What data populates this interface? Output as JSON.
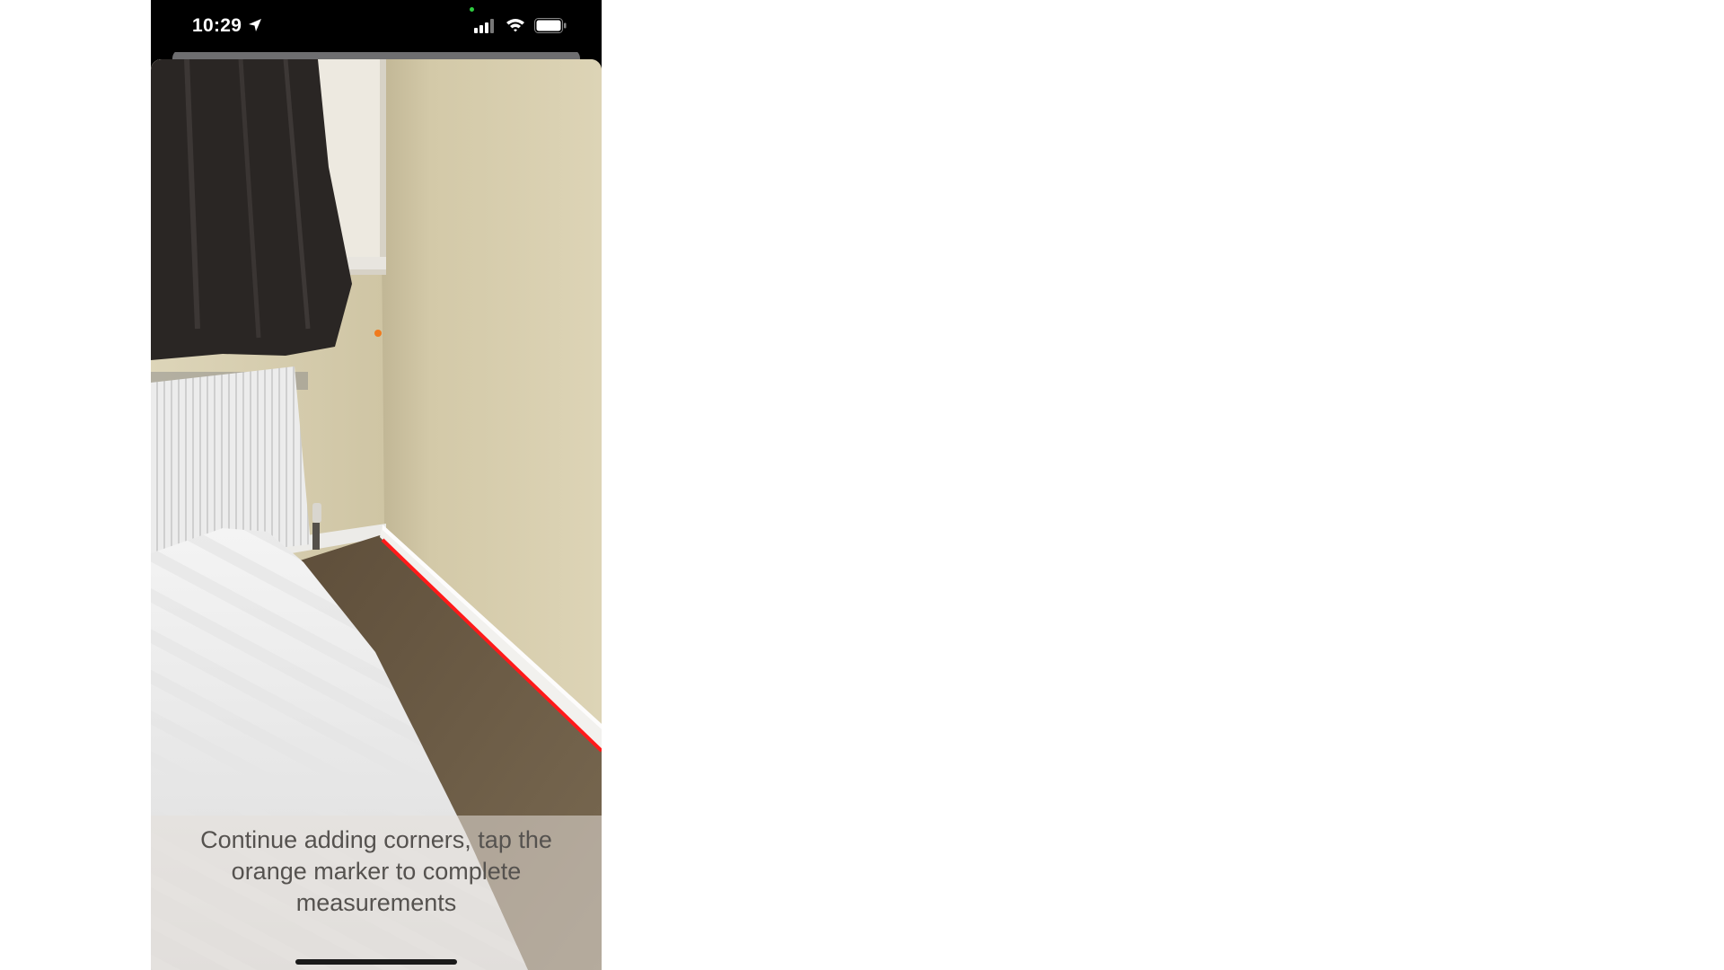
{
  "status_bar": {
    "time": "10:29",
    "icons": [
      "location-arrow-icon",
      "signal-icon",
      "wifi-icon",
      "battery-icon"
    ]
  },
  "camera": {
    "scene": [
      "curtain",
      "window-sill",
      "radiator",
      "bed",
      "carpet",
      "skirting-board",
      "wall"
    ],
    "measured_edge_color": "#ff1a1a",
    "marker_color": "#f07a1e"
  },
  "instruction": {
    "text": "Continue adding corners, tap the orange marker to complete measurements"
  },
  "colors": {
    "wall": "#d8cfae",
    "carpet": "#6b5a44",
    "status_bar_bg": "#000000"
  }
}
